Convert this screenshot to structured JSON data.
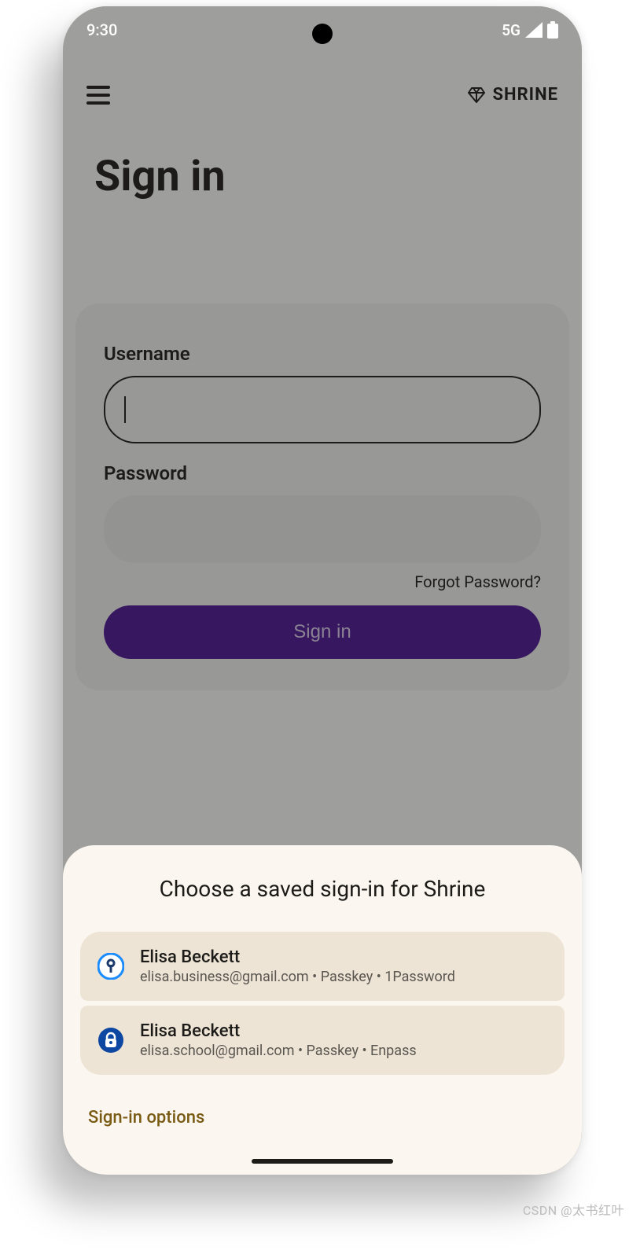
{
  "status_bar": {
    "time": "9:30",
    "network": "5G"
  },
  "app": {
    "brand": "SHRINE",
    "page_title": "Sign in",
    "form": {
      "username_label": "Username",
      "username_value": "",
      "password_label": "Password",
      "password_value": "",
      "forgot_link": "Forgot Password?",
      "signin_button": "Sign in"
    }
  },
  "credential_sheet": {
    "title": "Choose a saved sign-in for Shrine",
    "items": [
      {
        "icon": "1password-icon",
        "name": "Elisa Beckett",
        "detail": "elisa.business@gmail.com  •  Passkey  •  1Password"
      },
      {
        "icon": "enpass-icon",
        "name": "Elisa Beckett",
        "detail": "elisa.school@gmail.com  •  Passkey  •  Enpass"
      }
    ],
    "options_label": "Sign-in options"
  },
  "watermark": "CSDN @太书红叶"
}
